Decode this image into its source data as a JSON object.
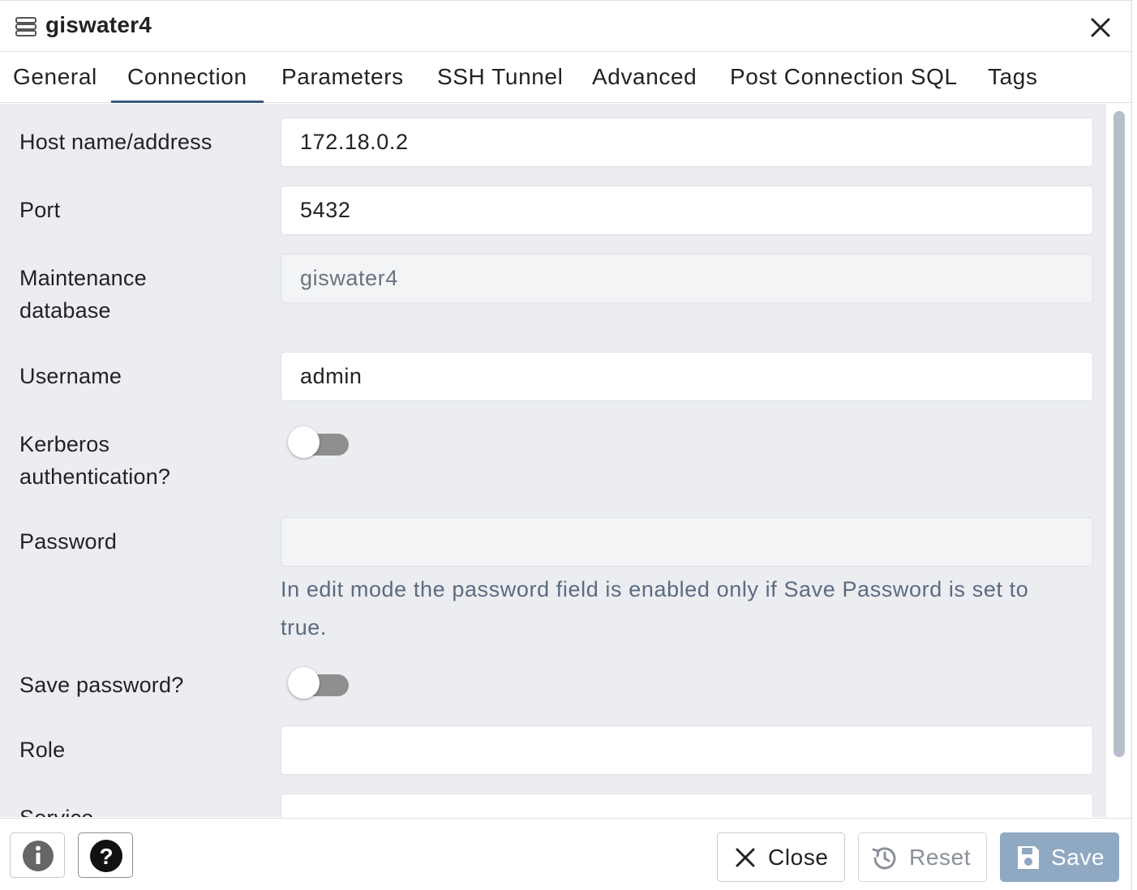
{
  "dialog": {
    "title": "giswater4",
    "title_icon": "server-icon",
    "close_icon": "close-icon"
  },
  "tabs": [
    {
      "label": "General"
    },
    {
      "label": "Connection",
      "active": true
    },
    {
      "label": "Parameters"
    },
    {
      "label": "SSH Tunnel"
    },
    {
      "label": "Advanced"
    },
    {
      "label": "Post Connection SQL"
    },
    {
      "label": "Tags"
    }
  ],
  "form": {
    "host": {
      "label": "Host name/address",
      "value": "172.18.0.2"
    },
    "port": {
      "label": "Port",
      "value": "5432"
    },
    "maintenance_db": {
      "label_line1": "Maintenance",
      "label_line2": "database",
      "value": "giswater4",
      "disabled": true
    },
    "username": {
      "label": "Username",
      "value": "admin"
    },
    "kerberos": {
      "label_line1": "Kerberos",
      "label_line2": "authentication?",
      "enabled": false
    },
    "password": {
      "label": "Password",
      "value": "",
      "hint_line1": "In edit mode the password field is enabled only if Save Password is set to",
      "hint_line2": "true."
    },
    "save_password": {
      "label": "Save password?",
      "enabled": false
    },
    "role": {
      "label": "Role",
      "value": ""
    },
    "service": {
      "label": "Service",
      "value": ""
    }
  },
  "footer": {
    "info_icon": "info-icon",
    "help_icon": "help-icon",
    "close_label": "Close",
    "reset_label": "Reset",
    "save_label": "Save"
  },
  "colors": {
    "accent": "#3a5a80",
    "body_bg": "#ebedf1",
    "save_button_bg": "#8fa9c3",
    "toggle_off": "#8f8f8f",
    "hint_text": "#5c6b81"
  }
}
